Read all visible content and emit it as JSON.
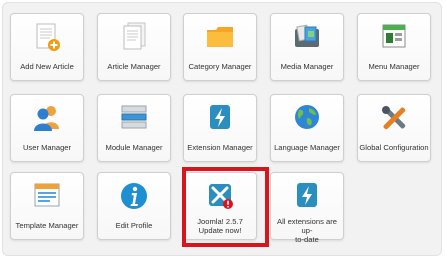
{
  "tiles": [
    {
      "label": "Add New Article",
      "icon": "add-new-article-icon"
    },
    {
      "label": "Article Manager",
      "icon": "article-manager-icon"
    },
    {
      "label": "Category Manager",
      "icon": "folder-icon"
    },
    {
      "label": "Media Manager",
      "icon": "media-manager-icon"
    },
    {
      "label": "Menu Manager",
      "icon": "menu-manager-icon"
    },
    {
      "label": "User Manager",
      "icon": "users-icon"
    },
    {
      "label": "Module Manager",
      "icon": "module-manager-icon"
    },
    {
      "label": "Extension Manager",
      "icon": "extension-icon"
    },
    {
      "label": "Language Manager",
      "icon": "globe-icon"
    },
    {
      "label": "Global Configuration",
      "icon": "tools-icon"
    },
    {
      "label": "Template Manager",
      "icon": "template-manager-icon"
    },
    {
      "label": "Edit Profile",
      "icon": "info-icon"
    },
    {
      "label_line1": "Joomla! 2.5.7",
      "label_line2": "Update now!",
      "icon": "joomla-update-icon"
    },
    {
      "label_line1": "All extensions are up-",
      "label_line2": "to-date",
      "icon": "extension-check-icon"
    }
  ],
  "highlight_color": "#d8141c"
}
